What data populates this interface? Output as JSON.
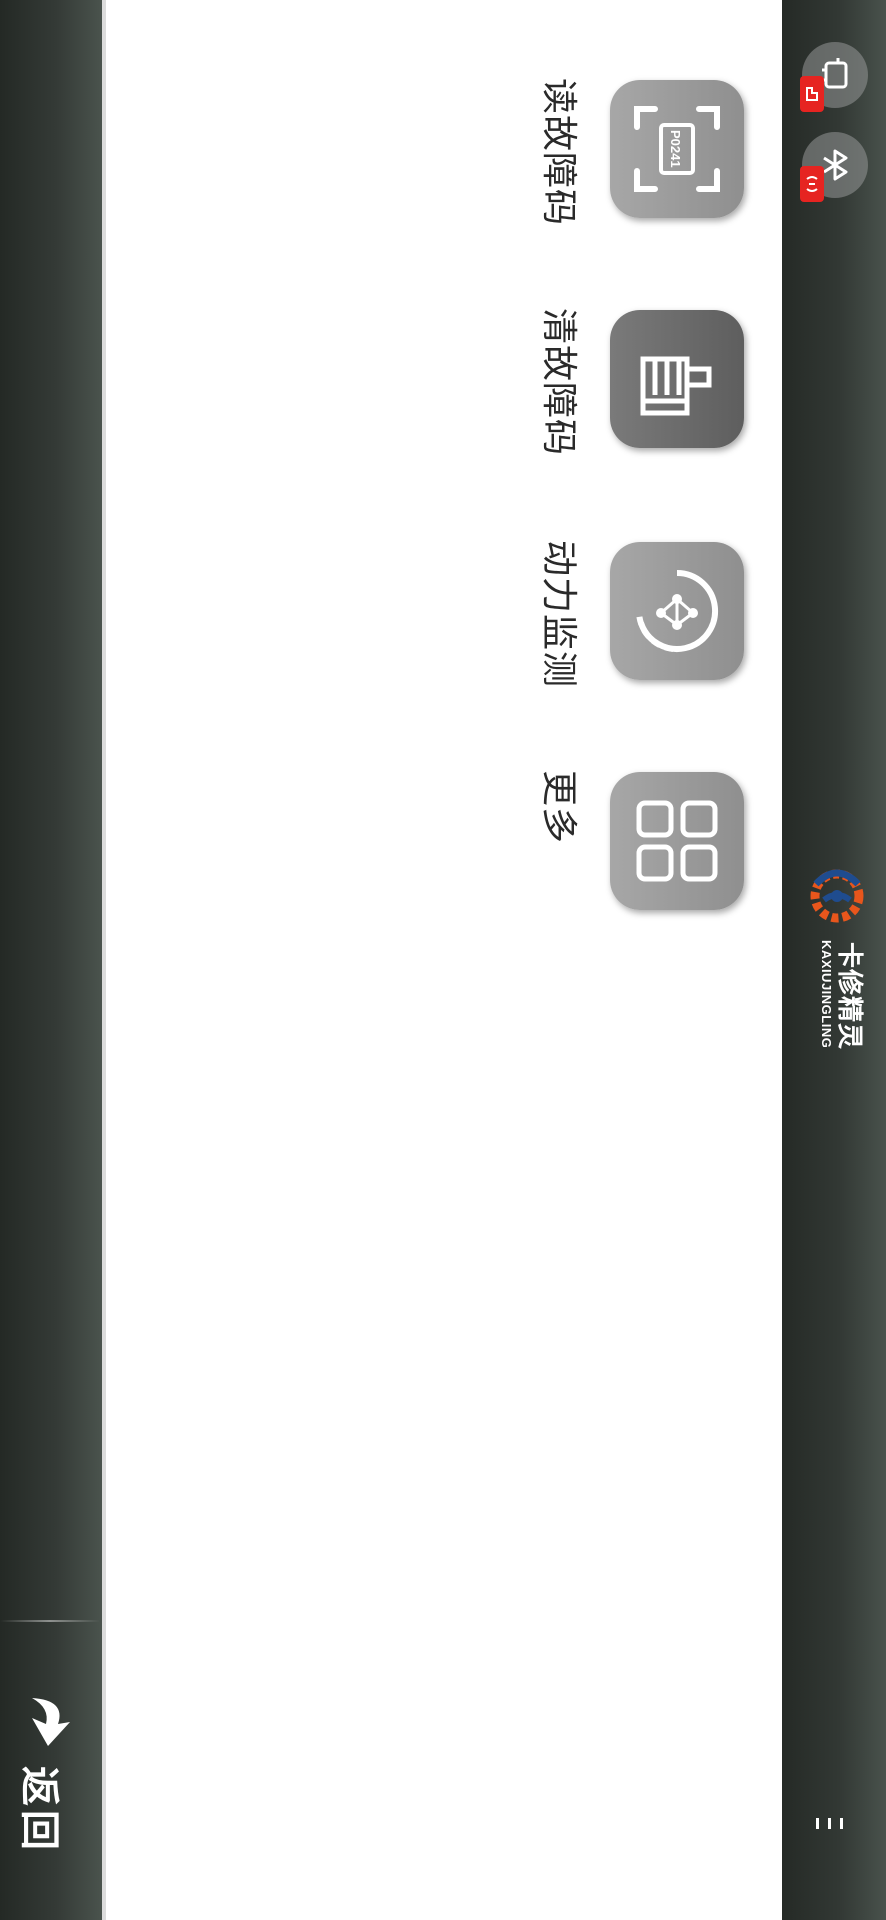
{
  "header": {
    "brand_name": "卡修精灵",
    "brand_pinyin": "KAXIUJINGLING",
    "status_icons": [
      "vci-connection-icon",
      "bluetooth-icon"
    ],
    "menu_icon": "more-menu-icon"
  },
  "functions": [
    {
      "label": "读故障码",
      "icon": "read-code-icon",
      "code_text": "P0241"
    },
    {
      "label": "清故障码",
      "icon": "clear-code-brush-icon"
    },
    {
      "label": "动力监测",
      "icon": "power-monitor-icon"
    },
    {
      "label": "更多",
      "icon": "grid-more-icon"
    }
  ],
  "footer": {
    "back_label": "返回",
    "back_icon": "back-arrow-icon"
  },
  "colors": {
    "bar_dark": "#2a302c",
    "tile_gray": "#9a9a9a",
    "tile_dark": "#6a6a6a",
    "badge_red": "#e62421",
    "logo_blue": "#1f4c8f",
    "logo_orange": "#e8561c"
  }
}
